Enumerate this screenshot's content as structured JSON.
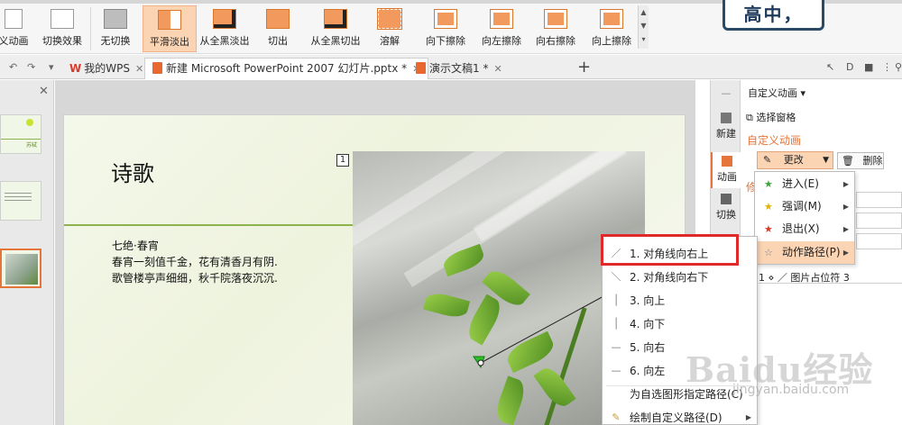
{
  "ribbon": {
    "items": [
      {
        "label": "义动画"
      },
      {
        "label": "切换效果"
      },
      {
        "label": "无切换"
      },
      {
        "label": "平滑淡出"
      },
      {
        "label": "从全黑淡出"
      },
      {
        "label": "切出"
      },
      {
        "label": "从全黑切出"
      },
      {
        "label": "溶解"
      },
      {
        "label": "向下擦除"
      },
      {
        "label": "向左擦除"
      },
      {
        "label": "向右擦除"
      },
      {
        "label": "向上擦除"
      }
    ],
    "badge_text": "高中，"
  },
  "tabbar": {
    "tabs": [
      {
        "label": "我的WPS",
        "logo": "W"
      },
      {
        "label": "新建 Microsoft PowerPoint 2007 幻灯片.pptx *"
      },
      {
        "label": "演示文稿1 *"
      }
    ],
    "add_tab": "+"
  },
  "slide": {
    "title": "诗歌",
    "poem_title": "七绝·春宵",
    "poem_lines": [
      "春宵一刻值千金，花有清香月有阴.",
      "歌管楼亭声细细，秋千院落夜沉沉."
    ],
    "animation_tag": "1",
    "thumb_tiny_text": "苏轼"
  },
  "pane_rail": {
    "items": [
      {
        "label": "新建"
      },
      {
        "label": "动画"
      },
      {
        "label": "切换"
      }
    ]
  },
  "pane": {
    "title": "自定义动画",
    "select_pane": "选择窗格",
    "section_title": "自定义动画",
    "modify_label": "更改",
    "delete_label": "删除",
    "partial_label": "修",
    "anim_list_row": "1 ⋄ ／ 图片占位符 3"
  },
  "menu_effect_types": {
    "items": [
      {
        "label": "进入(E)",
        "star_color": "#3aa53a"
      },
      {
        "label": "强调(M)",
        "star_color": "#e0b400"
      },
      {
        "label": "退出(X)",
        "star_color": "#d83b2b"
      },
      {
        "label": "动作路径(P)",
        "star_color": "#7a7a9a"
      }
    ]
  },
  "menu_motion_paths": {
    "items": [
      {
        "label": "1. 对角线向右上",
        "icon": "／"
      },
      {
        "label": "2. 对角线向右下",
        "icon": "＼"
      },
      {
        "label": "3. 向上",
        "icon": "│"
      },
      {
        "label": "4. 向下",
        "icon": "│"
      },
      {
        "label": "5. 向右",
        "icon": "—"
      },
      {
        "label": "6. 向左",
        "icon": "—"
      },
      {
        "label": "为自选图形指定路径(C)",
        "icon": ""
      },
      {
        "label": "绘制自定义路径(D)",
        "icon": "✎"
      }
    ]
  },
  "watermark": {
    "text": "Baidu经验",
    "url": "jingyan.baidu.com"
  },
  "colors": {
    "accent": "#e5753a",
    "highlight_box": "#e02a2a",
    "hover_bg": "#fbd4b4",
    "slide_rule": "#8cb34d"
  }
}
